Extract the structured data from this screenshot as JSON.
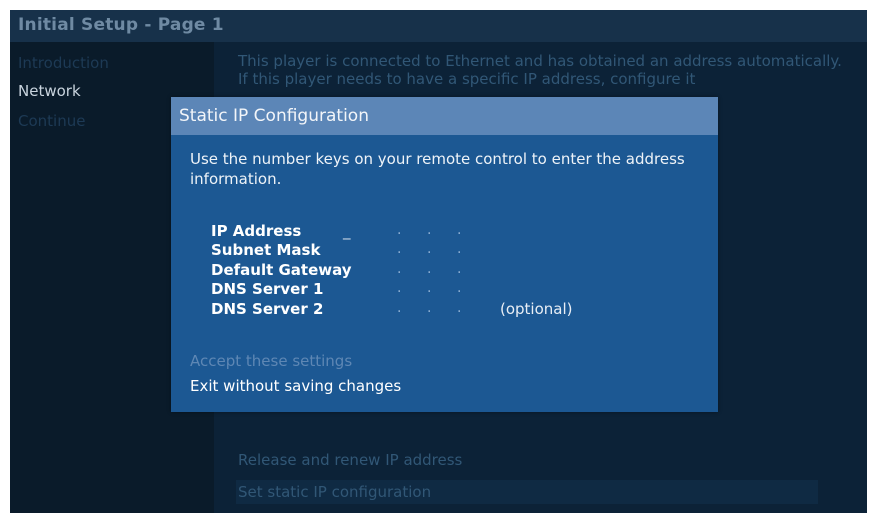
{
  "header": {
    "title": "Initial Setup - Page 1"
  },
  "nav": {
    "items": [
      {
        "label": "Introduction",
        "state": "dim"
      },
      {
        "label": "Network",
        "state": "active"
      },
      {
        "label": "Continue",
        "state": "dim"
      }
    ]
  },
  "content": {
    "intro_text": "This player is connected to Ethernet and has obtained an address automatically. If this player needs to have a specific IP address, configure it",
    "options": [
      {
        "label": "Release and renew IP address"
      },
      {
        "label": "Set static IP configuration"
      }
    ]
  },
  "dialog": {
    "title": "Static IP Configuration",
    "instructions": "Use the number keys on your remote control to enter the address information.",
    "fields": [
      {
        "label": "IP Address",
        "note": ""
      },
      {
        "label": "Subnet Mask",
        "note": ""
      },
      {
        "label": "Default Gateway",
        "note": ""
      },
      {
        "label": "DNS Server 1",
        "note": ""
      },
      {
        "label": "DNS Server 2",
        "note": "(optional)"
      }
    ],
    "cursor": "_",
    "separator": ".",
    "accept_label": "Accept these settings",
    "exit_label": "Exit without saving changes"
  },
  "colors": {
    "dialog_bg": "#1c5893",
    "dialog_header": "#5c86b7",
    "screen_bg": "#0a1b2a"
  }
}
